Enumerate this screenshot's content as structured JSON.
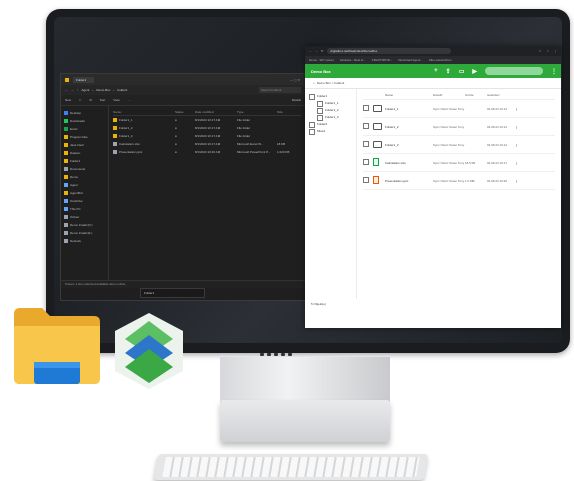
{
  "explorer": {
    "tab_title": "Folder1",
    "breadcrumb": [
      "Agent",
      "Demo Box",
      "Folder1"
    ],
    "search_placeholder": "Search Folder1",
    "toolbar": {
      "new_label": "New",
      "sort_label": "Sort",
      "view_label": "View",
      "details_label": "Details"
    },
    "nav_items": [
      {
        "label": "Desktop",
        "color": "#3b82f6"
      },
      {
        "label": "Downloads",
        "color": "#22c55e"
      },
      {
        "label": "Excel",
        "color": "#16a34a"
      },
      {
        "label": "Program files",
        "color": "#eab308"
      },
      {
        "label": "Java Intell",
        "color": "#eab308"
      },
      {
        "label": "Dateien",
        "color": "#eab308"
      },
      {
        "label": "Folder1",
        "color": "#eab308"
      },
      {
        "label": "Documents",
        "color": "#9ca3af"
      },
      {
        "label": "Demo",
        "color": "#eab308"
      },
      {
        "label": "Agent",
        "color": "#60a5fa"
      },
      {
        "label": "AgentBrd",
        "color": "#eab308"
      },
      {
        "label": "OneDrive",
        "color": "#60a5fa"
      },
      {
        "label": "This PC",
        "color": "#60a5fa"
      },
      {
        "label": "Ordner",
        "color": "#9ca3af"
      },
      {
        "label": "Demo Install (D:)",
        "color": "#9ca3af"
      },
      {
        "label": "Demo Install (E:)",
        "color": "#9ca3af"
      },
      {
        "label": "Network",
        "color": "#9ca3af"
      }
    ],
    "columns": {
      "name": "Name",
      "status": "Status",
      "date": "Date modified",
      "type": "Type",
      "size": "Size"
    },
    "rows": [
      {
        "name": "Folder1_1",
        "date": "8/1/2023 10:17 AM",
        "type": "File folder",
        "size": ""
      },
      {
        "name": "Folder1_2",
        "date": "8/1/2023 10:17 AM",
        "type": "File folder",
        "size": ""
      },
      {
        "name": "Folder1_3",
        "date": "8/1/2023 10:17 AM",
        "type": "File folder",
        "size": ""
      },
      {
        "name": "Calculation.xlsx",
        "date": "8/1/2023 10:17 AM",
        "type": "Microsoft Excel W...",
        "size": "18 KB"
      },
      {
        "name": "Presentation.pptx",
        "date": "8/1/2023 10:20 AM",
        "type": "Microsoft PowerPoint P...",
        "size": "1.020 KB"
      }
    ],
    "status_text": "5 items   1 item selected   Available when online",
    "sub_window_label": "Folder1"
  },
  "browser": {
    "url": "digitalbox.de/#/webclient/DemoBox",
    "bookmarks": [
      "Demo - WC (save)",
      "windows - Rest lo...",
      "FRACTIZION...",
      "Download Agent...",
      "Alle Lesezeichen"
    ],
    "app_title": "Demo Box",
    "breadcrumb": "Demo Box > Folder1",
    "tree": [
      "Folder1",
      "Folder1_1",
      "Folder1_2",
      "Folder1_3",
      "Folder2",
      "Mixed"
    ],
    "columns": {
      "name": "Name",
      "created_by": "Erstellt",
      "size": "Größe",
      "modified": "Geändert"
    },
    "rows": [
      {
        "kind": "folder",
        "name": "Folder1_1",
        "created_by": "Sync Client Tester Tony",
        "size": "",
        "modified": "04.08.23 10:12"
      },
      {
        "kind": "folder",
        "name": "Folder1_2",
        "created_by": "Sync Client Tester Tony",
        "size": "",
        "modified": "04.08.23 10:12"
      },
      {
        "kind": "folder",
        "name": "Folder1_3",
        "created_by": "Sync Client Tester Tony",
        "size": "",
        "modified": "04.08.23 10:12"
      },
      {
        "kind": "excel",
        "name": "Calculation.xlsx",
        "created_by": "Sync Client Tester Tony",
        "size": "18.5 kB",
        "modified": "04.08.23 10:17"
      },
      {
        "kind": "ppt",
        "name": "Presentation.pptx",
        "created_by": "Sync Client Tester Tony",
        "size": "1.0 MB",
        "modified": "04.08.23 10:20"
      }
    ],
    "footer": "5 Objekt(e)"
  },
  "colors": {
    "brand_green": "#2eaa3a",
    "folder_yellow": "#f5c24a",
    "folder_blue": "#1f7ad6"
  }
}
